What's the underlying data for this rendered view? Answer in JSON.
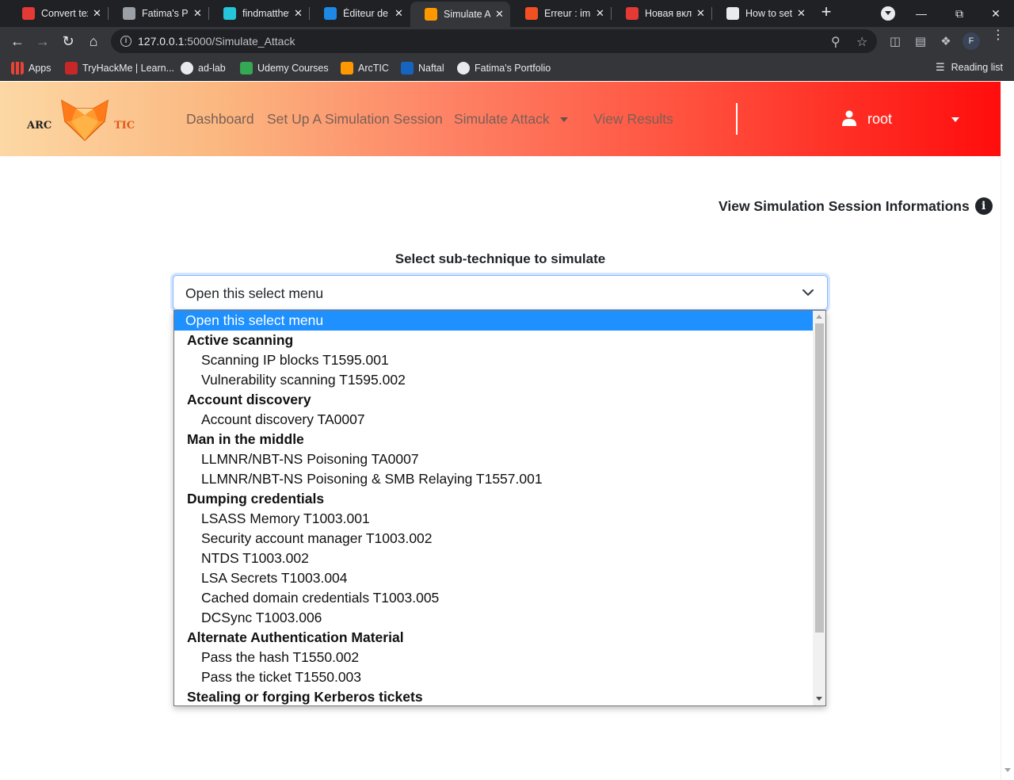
{
  "browser": {
    "tabs": [
      {
        "title": "Convert tex",
        "favicon": "t2i-favicon",
        "color": "#e53935"
      },
      {
        "title": "Fatima's Por",
        "favicon": "globe-favicon",
        "color": "#9aa0a6"
      },
      {
        "title": "findmatthew",
        "favicon": "m-favicon",
        "color": "#26c6da"
      },
      {
        "title": "Éditeur de C",
        "favicon": "cv-favicon",
        "color": "#1e88e5"
      },
      {
        "title": "Simulate At",
        "favicon": "fox-favicon",
        "color": "#ff9800",
        "active": true
      },
      {
        "title": "Erreur : imp",
        "favicon": "microsoft-favicon",
        "color": "#f25022"
      },
      {
        "title": "Новая вкла",
        "favicon": "star-favicon",
        "color": "#e53935"
      },
      {
        "title": "How to set",
        "favicon": "globe-favicon",
        "color": "#e8eaed"
      }
    ],
    "url_host": "127.0.0.1",
    "url_path": ":5000/Simulate_Attack",
    "profile_initial": "F",
    "bookmarks": [
      {
        "label": "Apps",
        "icon": "apps-grid-icon"
      },
      {
        "label": "TryHackMe | Learn...",
        "icon": "tryhackme-icon"
      },
      {
        "label": "ad-lab",
        "icon": "globe-icon"
      },
      {
        "label": "Udemy Courses",
        "icon": "google-drive-icon"
      },
      {
        "label": "ArcTIC",
        "icon": "fox-icon"
      },
      {
        "label": "Naftal",
        "icon": "naftal-icon"
      },
      {
        "label": "Fatima's Portfolio",
        "icon": "briefcase-icon"
      }
    ],
    "reading_list": "Reading list"
  },
  "navbar": {
    "logo_left": "ARC",
    "logo_right": "TIC",
    "links": [
      "Dashboard",
      "Set Up A Simulation Session",
      "Simulate Attack",
      "View Results"
    ],
    "user": "root",
    "gradient_colors": [
      "#fcd8a4",
      "#fe8265",
      "#ff0d0d"
    ]
  },
  "main": {
    "session_info_link": "View Simulation Session Informations",
    "select_label": "Select sub-technique to simulate",
    "select_value": "Open this select menu",
    "options": [
      {
        "text": "Open this select menu",
        "kind": "selected"
      },
      {
        "text": "Active scanning",
        "kind": "group"
      },
      {
        "text": "Scanning IP blocks T1595.001",
        "kind": "item"
      },
      {
        "text": "Vulnerability scanning T1595.002",
        "kind": "item"
      },
      {
        "text": "Account discovery",
        "kind": "group"
      },
      {
        "text": "Account discovery TA0007",
        "kind": "item"
      },
      {
        "text": "Man in the middle",
        "kind": "group"
      },
      {
        "text": "LLMNR/NBT-NS Poisoning TA0007",
        "kind": "item"
      },
      {
        "text": "LLMNR/NBT-NS Poisoning & SMB Relaying T1557.001",
        "kind": "item"
      },
      {
        "text": "Dumping credentials",
        "kind": "group"
      },
      {
        "text": "LSASS Memory T1003.001",
        "kind": "item"
      },
      {
        "text": "Security account manager T1003.002",
        "kind": "item"
      },
      {
        "text": "NTDS T1003.002",
        "kind": "item"
      },
      {
        "text": "LSA Secrets T1003.004",
        "kind": "item"
      },
      {
        "text": "Cached domain credentials T1003.005",
        "kind": "item"
      },
      {
        "text": "DCSync T1003.006",
        "kind": "item"
      },
      {
        "text": "Alternate Authentication Material",
        "kind": "group"
      },
      {
        "text": "Pass the hash T1550.002",
        "kind": "item"
      },
      {
        "text": "Pass the ticket T1550.003",
        "kind": "item"
      },
      {
        "text": "Stealing or forging Kerberos tickets",
        "kind": "group"
      }
    ],
    "accent_color": "#1e90ff"
  }
}
